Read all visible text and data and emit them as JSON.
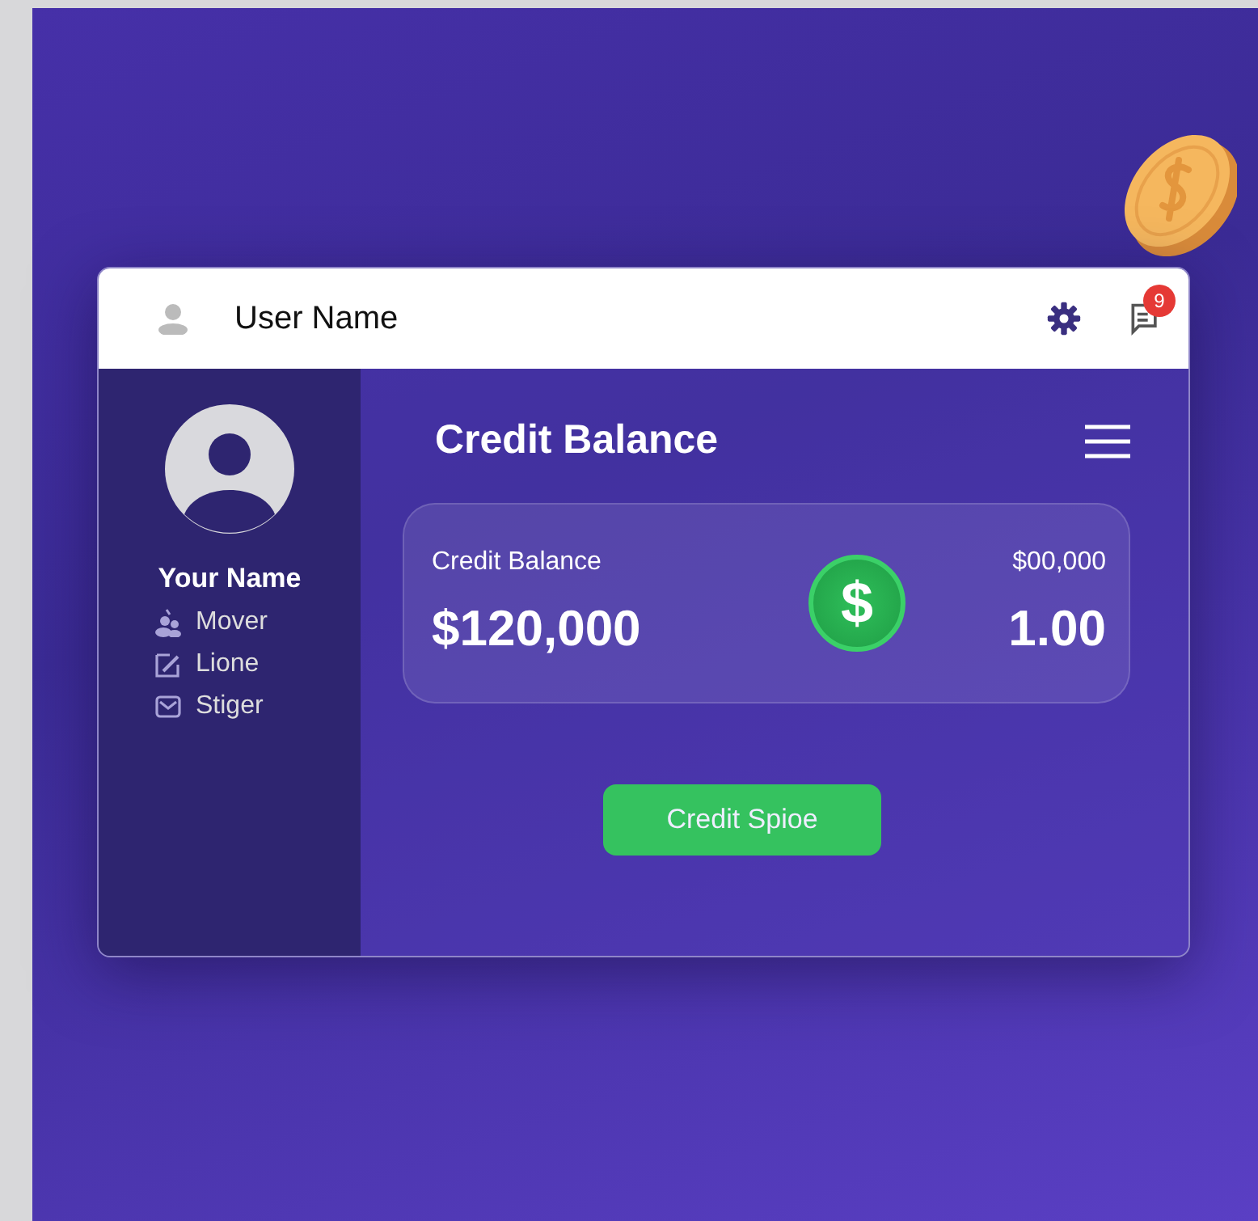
{
  "header": {
    "user_name": "User Name",
    "notification_count": "9"
  },
  "sidebar": {
    "profile_name": "Your Name",
    "items": [
      {
        "label": "Mover",
        "kind": "people"
      },
      {
        "label": "Lione",
        "kind": "edit"
      },
      {
        "label": "Stiger",
        "kind": "mail"
      }
    ]
  },
  "main": {
    "title": "Credit Balance",
    "balance_card": {
      "label": "Credit Balance",
      "amount": "$120,000",
      "coin_symbol": "$",
      "side_label": "$00,000",
      "side_value": "1.00"
    },
    "button": "Credit Spioe"
  }
}
